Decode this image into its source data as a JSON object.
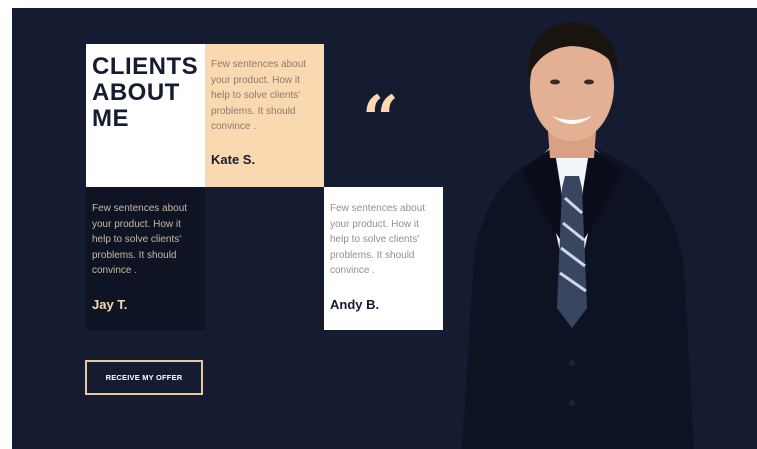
{
  "section": {
    "heading": "CLIENTS\nABOUT\nME"
  },
  "testimonials": [
    {
      "text": "Few sentences about your product. How it help to solve clients' problems. It should convince .",
      "author": "Kate S."
    },
    {
      "text": "Few sentences about your product. How it help to solve clients' problems. It should convince .",
      "author": "Jay T."
    },
    {
      "text": "Few sentences about your product. How it help to solve clients' problems. It should convince .",
      "author": "Andy B."
    }
  ],
  "quote_mark": "“",
  "cta": {
    "label": "RECEIVE MY OFFER"
  },
  "colors": {
    "background": "#151c31",
    "accent": "#fbd9b0",
    "dark_tile": "#0f1424",
    "white": "#ffffff"
  },
  "image": {
    "subject": "smiling-businessman-photo"
  }
}
